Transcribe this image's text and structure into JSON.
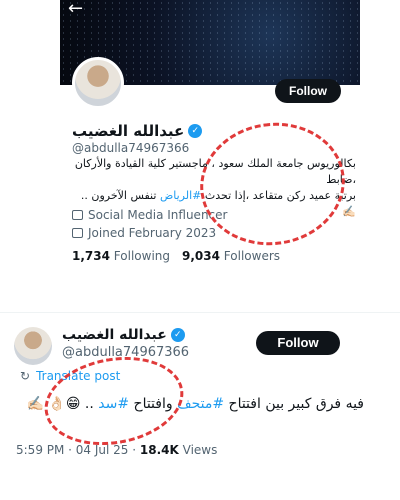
{
  "profile": {
    "back_icon": "arrow-left-icon",
    "follow_label": "Follow",
    "name": "عبدالله الغضيب",
    "handle": "@abdulla74967366",
    "bio_line1": "بكالوريوس جامعة الملك سعود ، ماجستير كلية القيادة والأركان ،ضابط",
    "bio_line2_pre": "برتبة عميد ركن متقاعد ،إذا تحدث",
    "bio_tag": "#الرياض",
    "bio_line2_post": "تنفس الآخرون .. ✍🏻",
    "category": "Social Media Influencer",
    "joined": "Joined February 2023",
    "following_count": "1,734",
    "following_label": "Following",
    "followers_count": "9,034",
    "followers_label": "Followers"
  },
  "tweet": {
    "name": "عبدالله الغضيب",
    "handle": "@abdulla74967366",
    "follow_label": "Follow",
    "translate_label": "Translate post",
    "text_pre": "فيه فرق كبير بين افتتاح",
    "tag1": "#متحف",
    "text_mid": "وافتتاح",
    "tag2": "#سد",
    "text_post": ".. 😁👌🏻 ✍🏻",
    "time": "5:59 PM · 04 Jul 25 · ",
    "views_count": "18.4K",
    "views_label": "Views"
  },
  "colors": {
    "accent": "#1d9bf0",
    "annotation": "#e03a3a"
  }
}
